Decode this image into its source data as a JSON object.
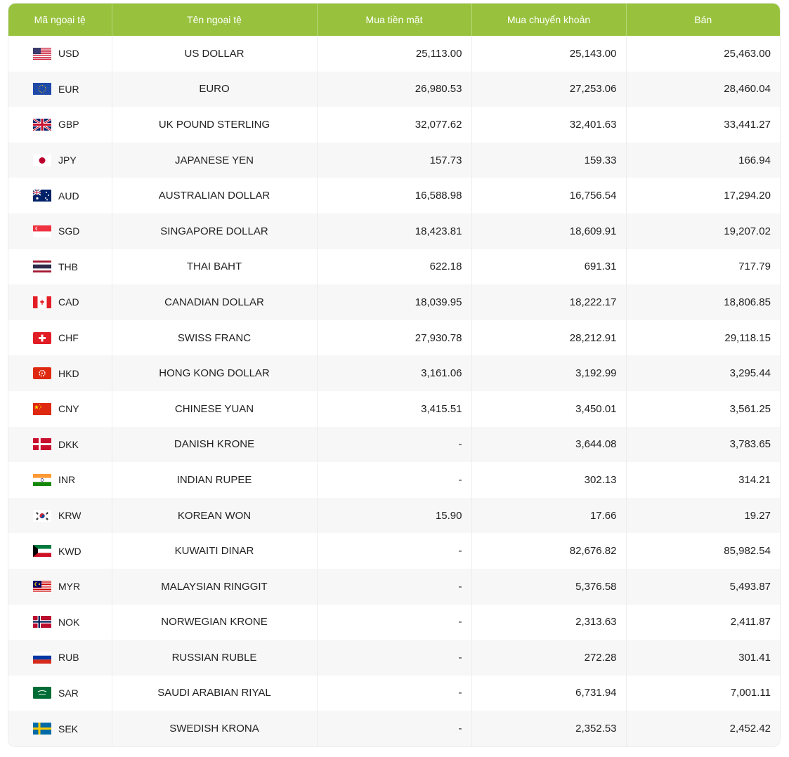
{
  "table": {
    "headers": [
      "Mã ngoại tệ",
      "Tên ngoại tệ",
      "Mua tiền mặt",
      "Mua chuyển khoản",
      "Bán"
    ],
    "rows": [
      {
        "code": "USD",
        "name": "US DOLLAR",
        "cash_buy": "25,113.00",
        "transfer_buy": "25,143.00",
        "sell": "25,463.00",
        "flag_icon": "us-flag-icon"
      },
      {
        "code": "EUR",
        "name": "EURO",
        "cash_buy": "26,980.53",
        "transfer_buy": "27,253.06",
        "sell": "28,460.04",
        "flag_icon": "eu-flag-icon"
      },
      {
        "code": "GBP",
        "name": "UK POUND STERLING",
        "cash_buy": "32,077.62",
        "transfer_buy": "32,401.63",
        "sell": "33,441.27",
        "flag_icon": "uk-flag-icon"
      },
      {
        "code": "JPY",
        "name": "JAPANESE YEN",
        "cash_buy": "157.73",
        "transfer_buy": "159.33",
        "sell": "166.94",
        "flag_icon": "japan-flag-icon"
      },
      {
        "code": "AUD",
        "name": "AUSTRALIAN DOLLAR",
        "cash_buy": "16,588.98",
        "transfer_buy": "16,756.54",
        "sell": "17,294.20",
        "flag_icon": "australia-flag-icon"
      },
      {
        "code": "SGD",
        "name": "SINGAPORE DOLLAR",
        "cash_buy": "18,423.81",
        "transfer_buy": "18,609.91",
        "sell": "19,207.02",
        "flag_icon": "singapore-flag-icon"
      },
      {
        "code": "THB",
        "name": "THAI BAHT",
        "cash_buy": "622.18",
        "transfer_buy": "691.31",
        "sell": "717.79",
        "flag_icon": "thailand-flag-icon"
      },
      {
        "code": "CAD",
        "name": "CANADIAN DOLLAR",
        "cash_buy": "18,039.95",
        "transfer_buy": "18,222.17",
        "sell": "18,806.85",
        "flag_icon": "canada-flag-icon"
      },
      {
        "code": "CHF",
        "name": "SWISS FRANC",
        "cash_buy": "27,930.78",
        "transfer_buy": "28,212.91",
        "sell": "29,118.15",
        "flag_icon": "switzerland-flag-icon"
      },
      {
        "code": "HKD",
        "name": "HONG KONG DOLLAR",
        "cash_buy": "3,161.06",
        "transfer_buy": "3,192.99",
        "sell": "3,295.44",
        "flag_icon": "hongkong-flag-icon"
      },
      {
        "code": "CNY",
        "name": "CHINESE YUAN",
        "cash_buy": "3,415.51",
        "transfer_buy": "3,450.01",
        "sell": "3,561.25",
        "flag_icon": "china-flag-icon"
      },
      {
        "code": "DKK",
        "name": "DANISH KRONE",
        "cash_buy": "-",
        "transfer_buy": "3,644.08",
        "sell": "3,783.65",
        "flag_icon": "denmark-flag-icon"
      },
      {
        "code": "INR",
        "name": "INDIAN RUPEE",
        "cash_buy": "-",
        "transfer_buy": "302.13",
        "sell": "314.21",
        "flag_icon": "india-flag-icon"
      },
      {
        "code": "KRW",
        "name": "KOREAN WON",
        "cash_buy": "15.90",
        "transfer_buy": "17.66",
        "sell": "19.27",
        "flag_icon": "korea-flag-icon"
      },
      {
        "code": "KWD",
        "name": "KUWAITI DINAR",
        "cash_buy": "-",
        "transfer_buy": "82,676.82",
        "sell": "85,982.54",
        "flag_icon": "kuwait-flag-icon"
      },
      {
        "code": "MYR",
        "name": "MALAYSIAN RINGGIT",
        "cash_buy": "-",
        "transfer_buy": "5,376.58",
        "sell": "5,493.87",
        "flag_icon": "malaysia-flag-icon"
      },
      {
        "code": "NOK",
        "name": "NORWEGIAN KRONE",
        "cash_buy": "-",
        "transfer_buy": "2,313.63",
        "sell": "2,411.87",
        "flag_icon": "norway-flag-icon"
      },
      {
        "code": "RUB",
        "name": "RUSSIAN RUBLE",
        "cash_buy": "-",
        "transfer_buy": "272.28",
        "sell": "301.41",
        "flag_icon": "russia-flag-icon"
      },
      {
        "code": "SAR",
        "name": "SAUDI ARABIAN RIYAL",
        "cash_buy": "-",
        "transfer_buy": "6,731.94",
        "sell": "7,001.11",
        "flag_icon": "saudi-flag-icon"
      },
      {
        "code": "SEK",
        "name": "SWEDISH KRONA",
        "cash_buy": "-",
        "transfer_buy": "2,352.53",
        "sell": "2,452.42",
        "flag_icon": "sweden-flag-icon"
      }
    ]
  },
  "colors": {
    "header_bg": "#98c23d",
    "header_text": "#ffffff",
    "row_alt_bg": "#f7f7f7"
  }
}
